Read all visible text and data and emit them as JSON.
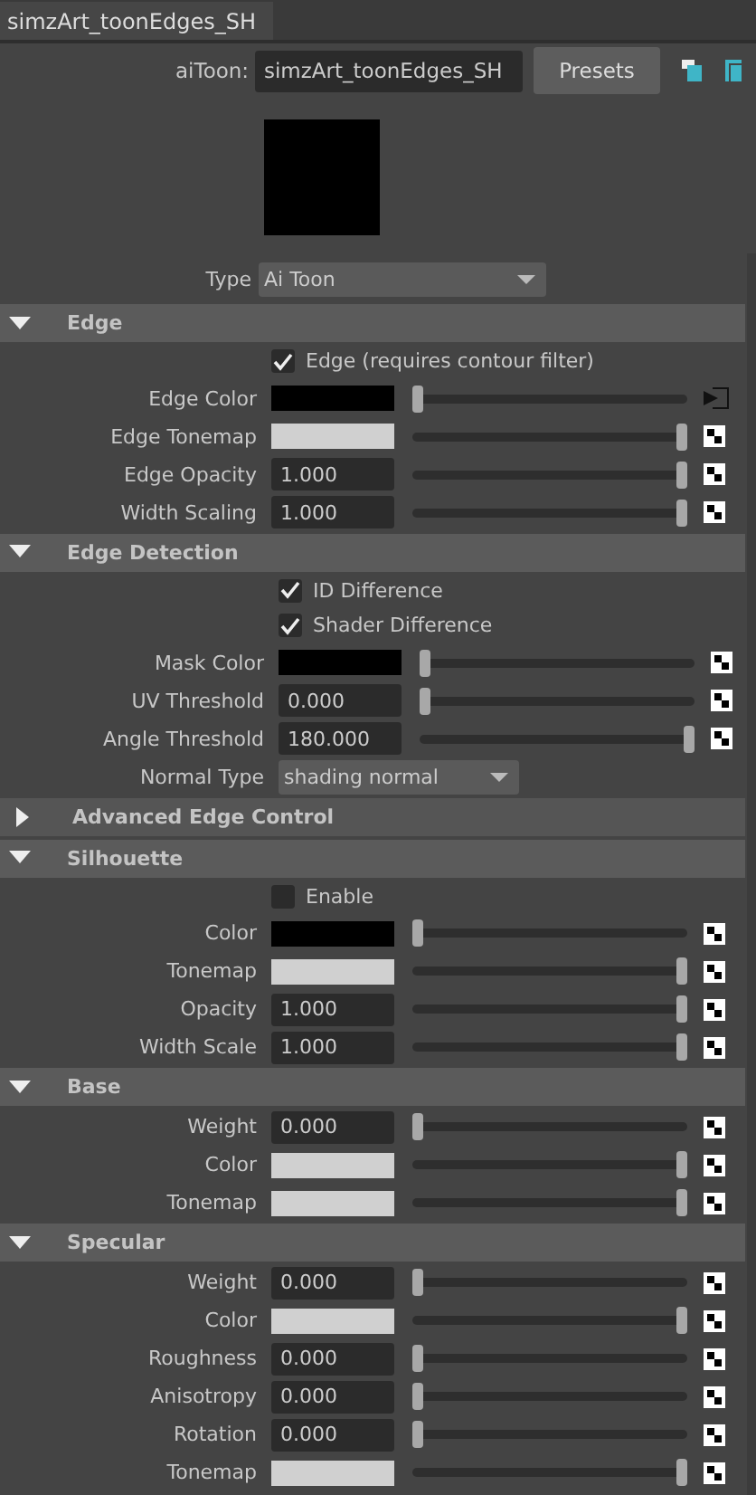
{
  "tab": {
    "label": "simzArt_toonEdges_SH",
    "selected": true
  },
  "node": {
    "label": "aiToon:",
    "value": "simzArt_toonEdges_SH",
    "presets": "Presets"
  },
  "swatch": {
    "color": "#000000"
  },
  "type": {
    "label": "Type",
    "value": "Ai Toon"
  },
  "sections": [
    {
      "title": "Edge",
      "expanded": true,
      "rows": [
        {
          "kind": "checkbox",
          "label": "Edge (requires contour filter)",
          "checked": true
        },
        {
          "kind": "color",
          "label": "Edge Color",
          "color": "#000000",
          "level": 0,
          "connected": true
        },
        {
          "kind": "color",
          "label": "Edge Tonemap",
          "color": "#d0d0d0",
          "level": 1,
          "connected": false
        },
        {
          "kind": "number",
          "label": "Edge Opacity",
          "value": "1.000",
          "level": 1,
          "connected": false
        },
        {
          "kind": "number",
          "label": "Width Scaling",
          "value": "1.000",
          "level": 1,
          "connected": false
        }
      ]
    },
    {
      "title": "Edge Detection",
      "expanded": true,
      "rows": [
        {
          "kind": "checkbox",
          "label": "ID Difference",
          "checked": true
        },
        {
          "kind": "checkbox",
          "label": "Shader Difference",
          "checked": true
        },
        {
          "kind": "color",
          "label": "Mask Color",
          "color": "#000000",
          "level": 0,
          "connected": false
        },
        {
          "kind": "number",
          "label": "UV Threshold",
          "value": "0.000",
          "level": 0,
          "connected": false
        },
        {
          "kind": "number",
          "label": "Angle Threshold",
          "value": "180.000",
          "level": 1,
          "connected": false
        },
        {
          "kind": "dropdown",
          "label": "Normal Type",
          "value": "shading normal"
        }
      ]
    },
    {
      "title": "Advanced Edge Control",
      "expanded": false
    },
    {
      "title": "Silhouette",
      "expanded": true,
      "rows": [
        {
          "kind": "checkbox",
          "label": "Enable",
          "checked": false
        },
        {
          "kind": "color",
          "label": "Color",
          "color": "#000000",
          "level": 0,
          "connected": false
        },
        {
          "kind": "color",
          "label": "Tonemap",
          "color": "#d0d0d0",
          "level": 1,
          "connected": false
        },
        {
          "kind": "number",
          "label": "Opacity",
          "value": "1.000",
          "level": 1,
          "connected": false
        },
        {
          "kind": "number",
          "label": "Width Scale",
          "value": "1.000",
          "level": 1,
          "connected": false
        }
      ]
    },
    {
      "title": "Base",
      "expanded": true,
      "rows": [
        {
          "kind": "number",
          "label": "Weight",
          "value": "0.000",
          "level": 0,
          "connected": false
        },
        {
          "kind": "color",
          "label": "Color",
          "color": "#d0d0d0",
          "level": 1,
          "connected": false
        },
        {
          "kind": "color",
          "label": "Tonemap",
          "color": "#d0d0d0",
          "level": 1,
          "connected": false
        }
      ]
    },
    {
      "title": "Specular",
      "expanded": true,
      "rows": [
        {
          "kind": "number",
          "label": "Weight",
          "value": "0.000",
          "level": 0,
          "connected": false
        },
        {
          "kind": "color",
          "label": "Color",
          "color": "#d0d0d0",
          "level": 1,
          "connected": false
        },
        {
          "kind": "number",
          "label": "Roughness",
          "value": "0.000",
          "level": 0,
          "connected": false
        },
        {
          "kind": "number",
          "label": "Anisotropy",
          "value": "0.000",
          "level": 0,
          "connected": false
        },
        {
          "kind": "number",
          "label": "Rotation",
          "value": "0.000",
          "level": 0,
          "connected": false
        },
        {
          "kind": "color",
          "label": "Tonemap",
          "color": "#d0d0d0",
          "level": 1,
          "connected": false
        }
      ]
    }
  ]
}
